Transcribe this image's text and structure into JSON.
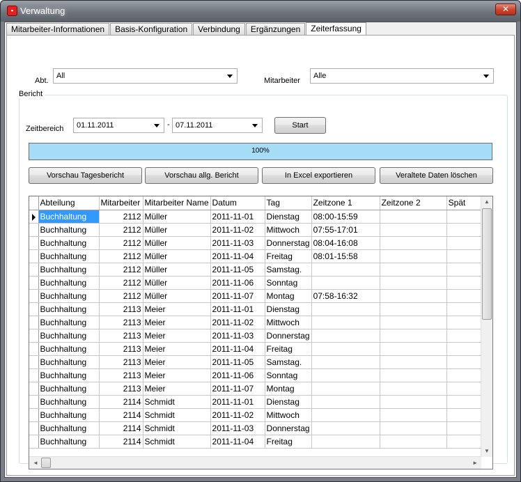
{
  "window": {
    "title": "Verwaltung",
    "close_glyph": "✕"
  },
  "tabs": [
    {
      "label": "Mitarbeiter-Informationen",
      "active": false
    },
    {
      "label": "Basis-Konfiguration",
      "active": false
    },
    {
      "label": "Verbindung",
      "active": false
    },
    {
      "label": "Ergänzungen",
      "active": false
    },
    {
      "label": "Zeiterfassung",
      "active": true
    }
  ],
  "filters": {
    "abt_label": "Abt.",
    "abt_value": "All",
    "mitarbeiter_label": "Mitarbeiter",
    "mitarbeiter_value": "Alle"
  },
  "bericht": {
    "group_title": "Bericht",
    "zeitbereich_label": "Zeitbereich",
    "date_from": "01.11.2011",
    "date_separator": "-",
    "date_to": "07.11.2011",
    "start_label": "Start",
    "progress_fraction": 1.0,
    "progress_text": "100%",
    "buttons": {
      "vorschau_tag": "Vorschau Tagesbericht",
      "vorschau_allg": "Vorschau allg. Bericht",
      "excel": "In Excel exportieren",
      "loeschen": "Veraltete Daten löschen"
    }
  },
  "grid": {
    "columns": [
      "Abteilung",
      "Mitarbeiter",
      "Mitarbeiter Name",
      "Datum",
      "Tag",
      "Zeitzone 1",
      "Zeitzone 2",
      "Spät"
    ],
    "rows": [
      [
        "Buchhaltung",
        "2112",
        "Müller",
        "2011-11-01",
        "Dienstag",
        "08:00-15:59",
        "",
        ""
      ],
      [
        "Buchhaltung",
        "2112",
        "Müller",
        "2011-11-02",
        "Mittwoch",
        "07:55-17:01",
        "",
        ""
      ],
      [
        "Buchhaltung",
        "2112",
        "Müller",
        "2011-11-03",
        "Donnerstag",
        "08:04-16:08",
        "",
        ""
      ],
      [
        "Buchhaltung",
        "2112",
        "Müller",
        "2011-11-04",
        "Freitag",
        "08:01-15:58",
        "",
        ""
      ],
      [
        "Buchhaltung",
        "2112",
        "Müller",
        "2011-11-05",
        "Samstag.",
        "",
        "",
        ""
      ],
      [
        "Buchhaltung",
        "2112",
        "Müller",
        "2011-11-06",
        "Sonntag",
        "",
        "",
        ""
      ],
      [
        "Buchhaltung",
        "2112",
        "Müller",
        "2011-11-07",
        "Montag",
        "07:58-16:32",
        "",
        ""
      ],
      [
        "Buchhaltung",
        "2113",
        "Meier",
        "2011-11-01",
        "Dienstag",
        "",
        "",
        ""
      ],
      [
        "Buchhaltung",
        "2113",
        "Meier",
        "2011-11-02",
        "Mittwoch",
        "",
        "",
        ""
      ],
      [
        "Buchhaltung",
        "2113",
        "Meier",
        "2011-11-03",
        "Donnerstag",
        "",
        "",
        ""
      ],
      [
        "Buchhaltung",
        "2113",
        "Meier",
        "2011-11-04",
        "Freitag",
        "",
        "",
        ""
      ],
      [
        "Buchhaltung",
        "2113",
        "Meier",
        "2011-11-05",
        "Samstag.",
        "",
        "",
        ""
      ],
      [
        "Buchhaltung",
        "2113",
        "Meier",
        "2011-11-06",
        "Sonntag",
        "",
        "",
        ""
      ],
      [
        "Buchhaltung",
        "2113",
        "Meier",
        "2011-11-07",
        "Montag",
        "",
        "",
        ""
      ],
      [
        "Buchhaltung",
        "2114",
        "Schmidt",
        "2011-11-01",
        "Dienstag",
        "",
        "",
        ""
      ],
      [
        "Buchhaltung",
        "2114",
        "Schmidt",
        "2011-11-02",
        "Mittwoch",
        "",
        "",
        ""
      ],
      [
        "Buchhaltung",
        "2114",
        "Schmidt",
        "2011-11-03",
        "Donnerstag",
        "",
        "",
        ""
      ],
      [
        "Buchhaltung",
        "2114",
        "Schmidt",
        "2011-11-04",
        "Freitag",
        "",
        "",
        ""
      ]
    ],
    "selected_row": 0
  },
  "colors": {
    "selection": "#3399ff",
    "progress": "#a6dcf6",
    "close": "#c9432d"
  }
}
